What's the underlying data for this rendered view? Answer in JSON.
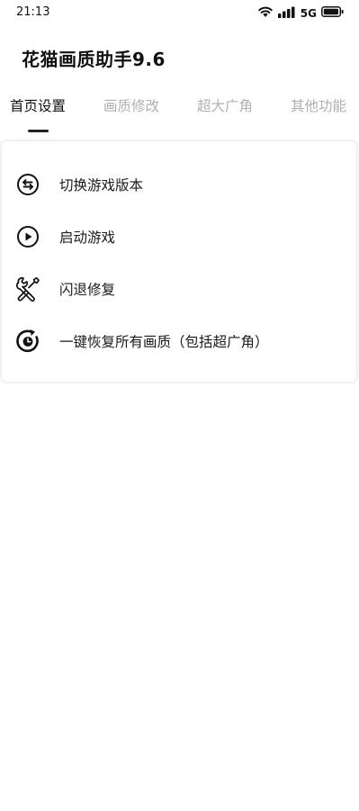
{
  "status_bar": {
    "time": "21:13",
    "network": "5G",
    "icons": [
      "wifi-icon",
      "signal-icon",
      "battery-icon"
    ]
  },
  "app": {
    "title": "花猫画质助手9.6"
  },
  "tabs": [
    {
      "label": "首页设置",
      "active": true
    },
    {
      "label": "画质修改",
      "active": false
    },
    {
      "label": "超大广角",
      "active": false
    },
    {
      "label": "其他功能",
      "active": false
    }
  ],
  "menu": {
    "items": [
      {
        "label": "切换游戏版本",
        "icon": "switch-icon"
      },
      {
        "label": "启动游戏",
        "icon": "play-icon"
      },
      {
        "label": "闪退修复",
        "icon": "tools-icon"
      },
      {
        "label": "一键恢复所有画质（包括超广角）",
        "icon": "restore-icon"
      }
    ]
  },
  "colors": {
    "active_tab": "#111111",
    "inactive_tab": "#b0b0b0",
    "indicator": "#222222",
    "background": "#ffffff"
  }
}
